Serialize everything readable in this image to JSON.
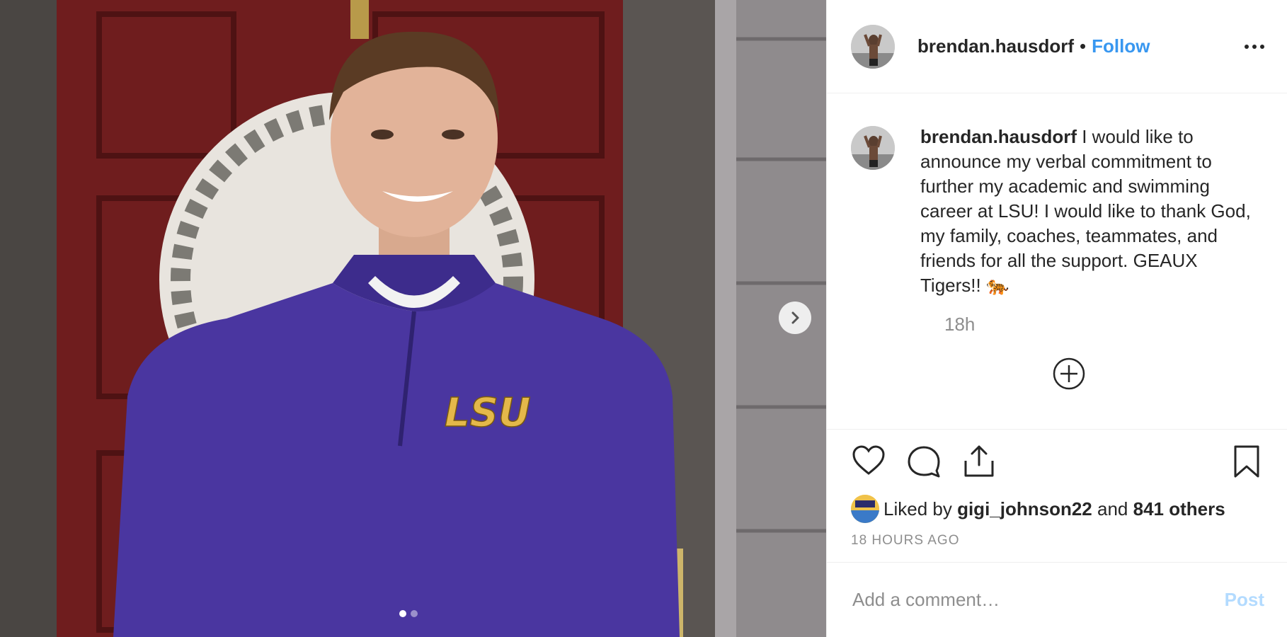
{
  "header": {
    "username": "brendan.hausdorf",
    "separator": "•",
    "follow_label": "Follow",
    "more_icon": "more-options-icon"
  },
  "caption": {
    "username": "brendan.hausdorf",
    "text": " I would like to announce my verbal commitment to further my academic and swimming career at LSU! I would like to thank God, my family, coaches, teammates, and friends for all the support. GEAUX Tigers!! 🐅",
    "time_ago": "18h"
  },
  "media": {
    "sweatshirt_text": "LSU",
    "carousel_count": 2,
    "carousel_active": 1
  },
  "likes": {
    "prefix": "Liked by ",
    "liker": "gigi_johnson22",
    "middle": " and ",
    "others": "841 others"
  },
  "timestamp": "18 HOURS AGO",
  "comment": {
    "placeholder": "Add a comment…",
    "post_label": "Post"
  },
  "colors": {
    "follow": "#3897f0",
    "post_disabled": "#b3dbff",
    "text": "#262626",
    "muted": "#8e8e8e"
  }
}
